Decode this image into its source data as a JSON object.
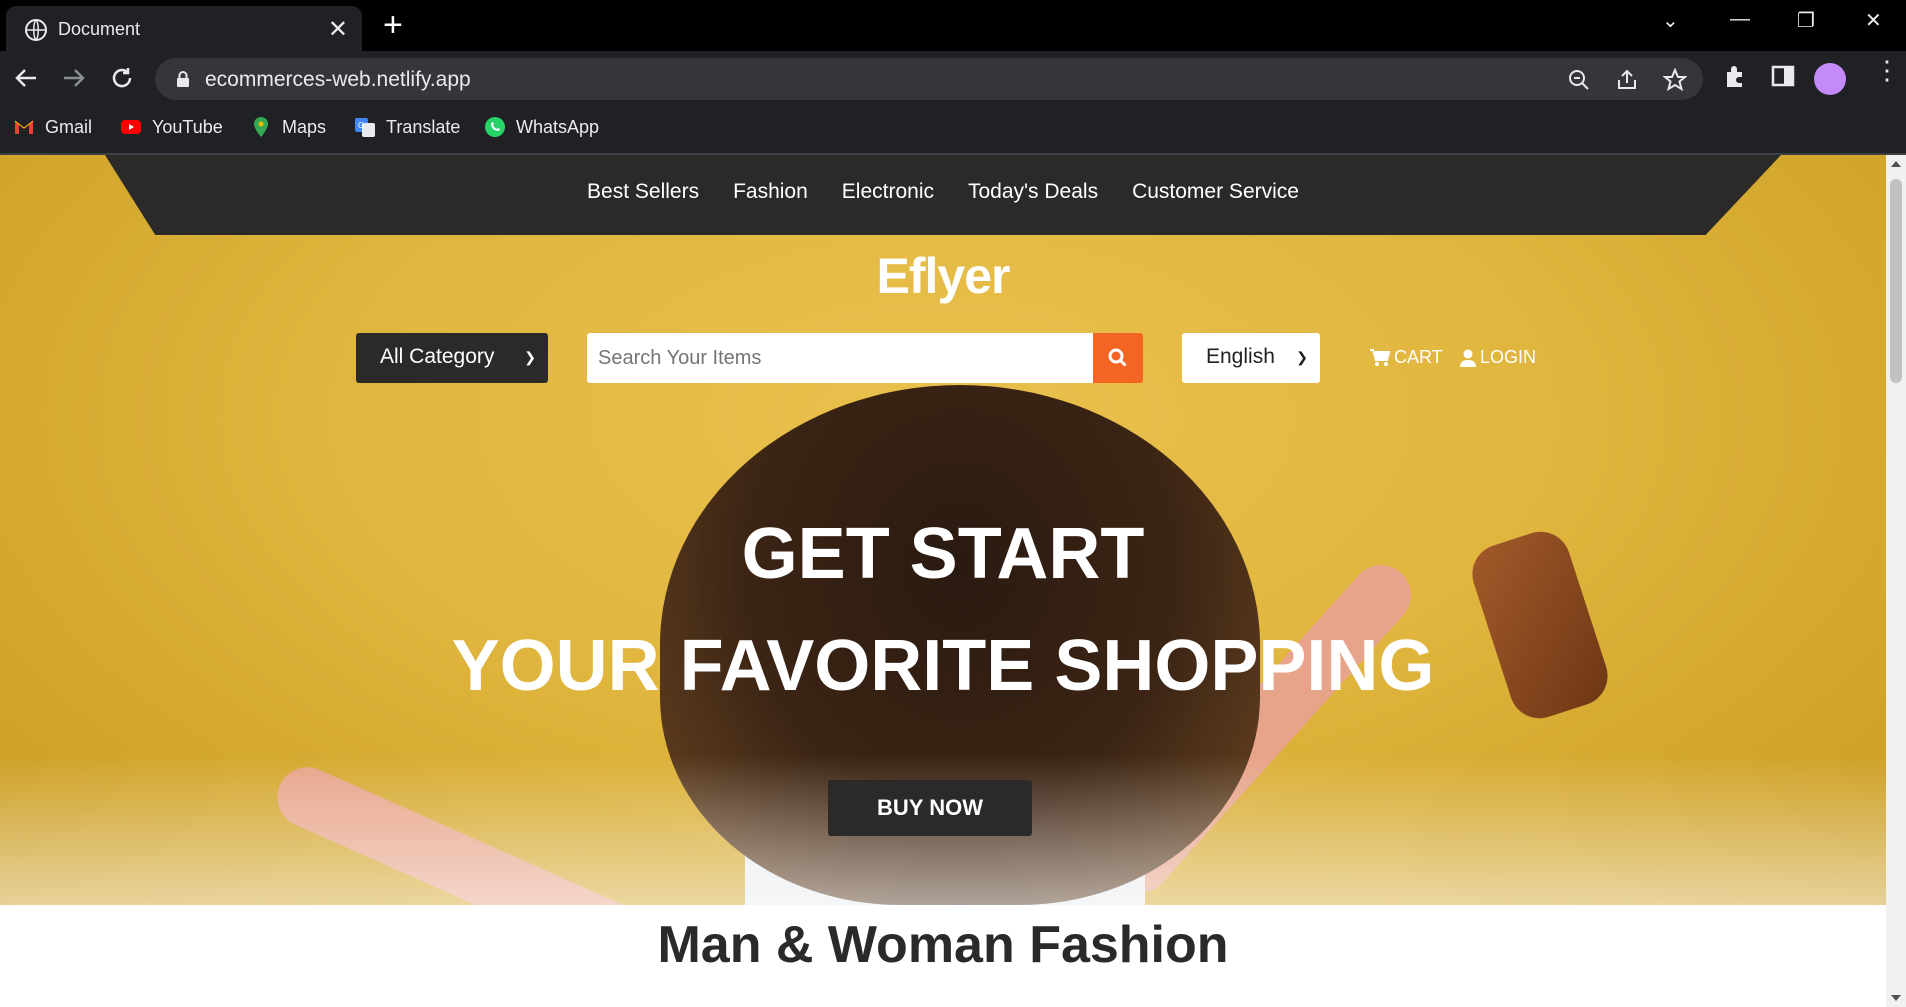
{
  "browser": {
    "tab_title": "Document",
    "url": "ecommerces-web.netlify.app",
    "bookmarks": [
      {
        "label": "Gmail",
        "icon": "gmail-icon"
      },
      {
        "label": "YouTube",
        "icon": "youtube-icon"
      },
      {
        "label": "Maps",
        "icon": "maps-icon"
      },
      {
        "label": "Translate",
        "icon": "translate-icon"
      },
      {
        "label": "WhatsApp",
        "icon": "whatsapp-icon"
      }
    ]
  },
  "site": {
    "nav": [
      "Best Sellers",
      "Fashion",
      "Electronic",
      "Today's Deals",
      "Customer Service"
    ],
    "logo": "Eflyer",
    "category_select": "All Category",
    "search_placeholder": "Search Your Items",
    "language_select": "English",
    "cart_label": "CART",
    "login_label": "LOGIN",
    "headline_line1": "GET START",
    "headline_line2": "YOUR FAVORITE SHOPPING",
    "buy_button": "BUY NOW",
    "section_title": "Man & Woman Fashion"
  },
  "colors": {
    "accent": "#f26522",
    "dark": "#2b2a29",
    "hero_bg": "#e0b63e"
  }
}
